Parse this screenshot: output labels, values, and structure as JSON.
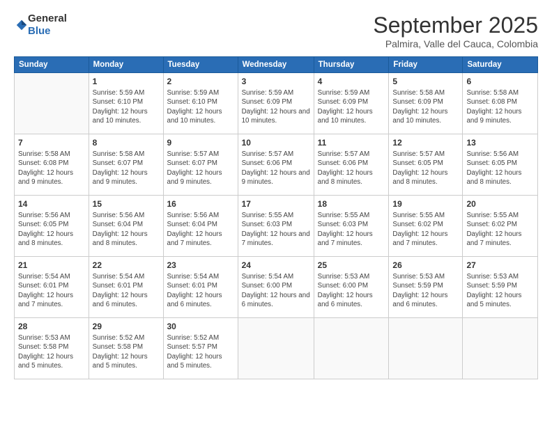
{
  "header": {
    "logo": {
      "line1": "General",
      "line2": "Blue"
    },
    "title": "September 2025",
    "location": "Palmira, Valle del Cauca, Colombia"
  },
  "calendar": {
    "weekdays": [
      "Sunday",
      "Monday",
      "Tuesday",
      "Wednesday",
      "Thursday",
      "Friday",
      "Saturday"
    ],
    "weeks": [
      [
        {
          "day": "",
          "info": ""
        },
        {
          "day": "1",
          "info": "Sunrise: 5:59 AM\nSunset: 6:10 PM\nDaylight: 12 hours\nand 10 minutes."
        },
        {
          "day": "2",
          "info": "Sunrise: 5:59 AM\nSunset: 6:10 PM\nDaylight: 12 hours\nand 10 minutes."
        },
        {
          "day": "3",
          "info": "Sunrise: 5:59 AM\nSunset: 6:09 PM\nDaylight: 12 hours\nand 10 minutes."
        },
        {
          "day": "4",
          "info": "Sunrise: 5:59 AM\nSunset: 6:09 PM\nDaylight: 12 hours\nand 10 minutes."
        },
        {
          "day": "5",
          "info": "Sunrise: 5:58 AM\nSunset: 6:09 PM\nDaylight: 12 hours\nand 10 minutes."
        },
        {
          "day": "6",
          "info": "Sunrise: 5:58 AM\nSunset: 6:08 PM\nDaylight: 12 hours\nand 9 minutes."
        }
      ],
      [
        {
          "day": "7",
          "info": "Sunrise: 5:58 AM\nSunset: 6:08 PM\nDaylight: 12 hours\nand 9 minutes."
        },
        {
          "day": "8",
          "info": "Sunrise: 5:58 AM\nSunset: 6:07 PM\nDaylight: 12 hours\nand 9 minutes."
        },
        {
          "day": "9",
          "info": "Sunrise: 5:57 AM\nSunset: 6:07 PM\nDaylight: 12 hours\nand 9 minutes."
        },
        {
          "day": "10",
          "info": "Sunrise: 5:57 AM\nSunset: 6:06 PM\nDaylight: 12 hours\nand 9 minutes."
        },
        {
          "day": "11",
          "info": "Sunrise: 5:57 AM\nSunset: 6:06 PM\nDaylight: 12 hours\nand 8 minutes."
        },
        {
          "day": "12",
          "info": "Sunrise: 5:57 AM\nSunset: 6:05 PM\nDaylight: 12 hours\nand 8 minutes."
        },
        {
          "day": "13",
          "info": "Sunrise: 5:56 AM\nSunset: 6:05 PM\nDaylight: 12 hours\nand 8 minutes."
        }
      ],
      [
        {
          "day": "14",
          "info": "Sunrise: 5:56 AM\nSunset: 6:05 PM\nDaylight: 12 hours\nand 8 minutes."
        },
        {
          "day": "15",
          "info": "Sunrise: 5:56 AM\nSunset: 6:04 PM\nDaylight: 12 hours\nand 8 minutes."
        },
        {
          "day": "16",
          "info": "Sunrise: 5:56 AM\nSunset: 6:04 PM\nDaylight: 12 hours\nand 7 minutes."
        },
        {
          "day": "17",
          "info": "Sunrise: 5:55 AM\nSunset: 6:03 PM\nDaylight: 12 hours\nand 7 minutes."
        },
        {
          "day": "18",
          "info": "Sunrise: 5:55 AM\nSunset: 6:03 PM\nDaylight: 12 hours\nand 7 minutes."
        },
        {
          "day": "19",
          "info": "Sunrise: 5:55 AM\nSunset: 6:02 PM\nDaylight: 12 hours\nand 7 minutes."
        },
        {
          "day": "20",
          "info": "Sunrise: 5:55 AM\nSunset: 6:02 PM\nDaylight: 12 hours\nand 7 minutes."
        }
      ],
      [
        {
          "day": "21",
          "info": "Sunrise: 5:54 AM\nSunset: 6:01 PM\nDaylight: 12 hours\nand 7 minutes."
        },
        {
          "day": "22",
          "info": "Sunrise: 5:54 AM\nSunset: 6:01 PM\nDaylight: 12 hours\nand 6 minutes."
        },
        {
          "day": "23",
          "info": "Sunrise: 5:54 AM\nSunset: 6:01 PM\nDaylight: 12 hours\nand 6 minutes."
        },
        {
          "day": "24",
          "info": "Sunrise: 5:54 AM\nSunset: 6:00 PM\nDaylight: 12 hours\nand 6 minutes."
        },
        {
          "day": "25",
          "info": "Sunrise: 5:53 AM\nSunset: 6:00 PM\nDaylight: 12 hours\nand 6 minutes."
        },
        {
          "day": "26",
          "info": "Sunrise: 5:53 AM\nSunset: 5:59 PM\nDaylight: 12 hours\nand 6 minutes."
        },
        {
          "day": "27",
          "info": "Sunrise: 5:53 AM\nSunset: 5:59 PM\nDaylight: 12 hours\nand 5 minutes."
        }
      ],
      [
        {
          "day": "28",
          "info": "Sunrise: 5:53 AM\nSunset: 5:58 PM\nDaylight: 12 hours\nand 5 minutes."
        },
        {
          "day": "29",
          "info": "Sunrise: 5:52 AM\nSunset: 5:58 PM\nDaylight: 12 hours\nand 5 minutes."
        },
        {
          "day": "30",
          "info": "Sunrise: 5:52 AM\nSunset: 5:57 PM\nDaylight: 12 hours\nand 5 minutes."
        },
        {
          "day": "",
          "info": ""
        },
        {
          "day": "",
          "info": ""
        },
        {
          "day": "",
          "info": ""
        },
        {
          "day": "",
          "info": ""
        }
      ]
    ]
  }
}
